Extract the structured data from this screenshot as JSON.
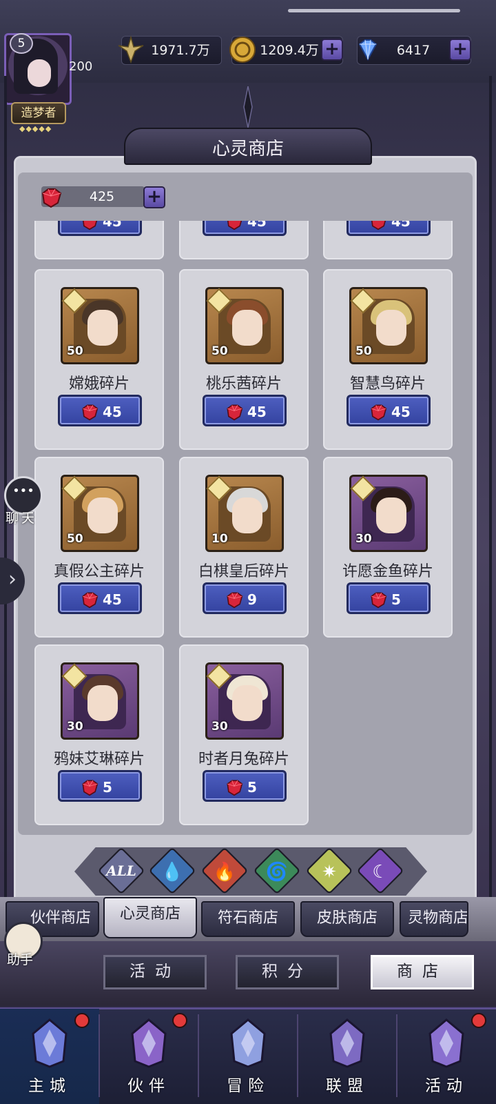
{
  "topbar": {
    "level": "5",
    "level_progress": "200",
    "title": "造梦者",
    "stars": "◆◆◆◆◆",
    "power": "1971.7万",
    "gold": "1209.4万",
    "diamonds": "6417",
    "plus": "+"
  },
  "shop": {
    "title": "心灵商店",
    "currency_amount": "425",
    "plus": "+"
  },
  "items": [
    {
      "name": "嫦娥碎片",
      "count": "50",
      "price": "45",
      "frame": "gold",
      "hair": "#4a3628"
    },
    {
      "name": "桃乐茜碎片",
      "count": "50",
      "price": "45",
      "frame": "gold",
      "hair": "#8a4d2c"
    },
    {
      "name": "智慧鸟碎片",
      "count": "50",
      "price": "45",
      "frame": "gold",
      "hair": "#d9c27a"
    },
    {
      "name": "真假公主碎片",
      "count": "50",
      "price": "45",
      "frame": "gold",
      "hair": "#d2a15e"
    },
    {
      "name": "白棋皇后碎片",
      "count": "10",
      "price": "9",
      "frame": "gold",
      "hair": "#d8d8d8"
    },
    {
      "name": "许愿金鱼碎片",
      "count": "30",
      "price": "5",
      "frame": "purple",
      "hair": "#2c1c18"
    },
    {
      "name": "鸦妹艾琳碎片",
      "count": "30",
      "price": "5",
      "frame": "purple",
      "hair": "#5a3a2c"
    },
    {
      "name": "时者月兔碎片",
      "count": "30",
      "price": "5",
      "frame": "purple",
      "hair": "#efe6d4"
    }
  ],
  "top_row_prices": [
    "45",
    "45",
    "45"
  ],
  "filters": [
    {
      "label": "ALL",
      "color": "#6a6e96",
      "glyph": ""
    },
    {
      "label": "",
      "color": "#3d6fb0",
      "glyph": "💧"
    },
    {
      "label": "",
      "color": "#c04a3a",
      "glyph": "🔥"
    },
    {
      "label": "",
      "color": "#3c8a5a",
      "glyph": "🌀"
    },
    {
      "label": "",
      "color": "#b8c25a",
      "glyph": "✷"
    },
    {
      "label": "",
      "color": "#7a4bb8",
      "glyph": "☾"
    }
  ],
  "tabs": [
    "伙伴商店",
    "心灵商店",
    "符石商店",
    "皮肤商店",
    "灵物商店"
  ],
  "active_tab": "心灵商店",
  "sub_buttons": [
    "活动",
    "积分",
    "商店"
  ],
  "nav": [
    {
      "label": "主城",
      "badge": true
    },
    {
      "label": "伙伴",
      "badge": true
    },
    {
      "label": "冒险",
      "badge": false
    },
    {
      "label": "联盟",
      "badge": false
    },
    {
      "label": "活动",
      "badge": true
    }
  ],
  "side": {
    "chat": "聊天",
    "helper": "助手",
    "arrow": "›",
    "chat_dots": "•••"
  },
  "colors": {
    "price_button": "#3e4eb0",
    "gem": "#d8253a",
    "panel": "#c8c8d1"
  }
}
